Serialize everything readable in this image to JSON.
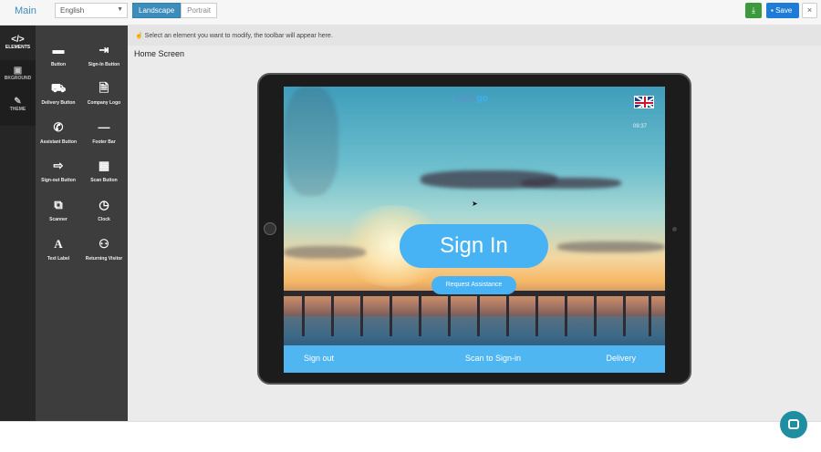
{
  "topbar": {
    "title": "Main",
    "language": "English",
    "orientation": [
      "Landscape",
      "Portrait"
    ],
    "download_icon": "download-icon",
    "save_label": "Save",
    "close_label": "×"
  },
  "rail": [
    {
      "label": "ELEMENTS",
      "icon": "</>"
    },
    {
      "label": "BKGROUND",
      "icon": "▣"
    },
    {
      "label": "THEME",
      "icon": "✎"
    }
  ],
  "palette": [
    {
      "label": "Button",
      "icon": "▬"
    },
    {
      "label": "Sign-In Button",
      "icon": "⇥"
    },
    {
      "label": "Delivery Button",
      "icon": "⛟"
    },
    {
      "label": "Company Logo",
      "icon": "🗎"
    },
    {
      "label": "Assistant Button",
      "icon": "✆"
    },
    {
      "label": "Footer Bar",
      "icon": "—"
    },
    {
      "label": "Sign-out Button",
      "icon": "⇨"
    },
    {
      "label": "Scan Button",
      "icon": "▦"
    },
    {
      "label": "Scanner",
      "icon": "⧉"
    },
    {
      "label": "Clock",
      "icon": "◷"
    },
    {
      "label": "Text Label",
      "icon": "A"
    },
    {
      "label": "Returning Visitor",
      "icon": "⚇"
    }
  ],
  "stage": {
    "hint": "Select an element you want to modify, the toolbar will appear here.",
    "screen_name": "Home Screen"
  },
  "device": {
    "logo_a": "team",
    "logo_b": "go",
    "time": "09:37",
    "signin_label": "Sign In",
    "assist_label": "Request Assistance",
    "footer": {
      "sign_out": "Sign out",
      "scan": "Scan to Sign-in",
      "delivery": "Delivery"
    }
  },
  "colors": {
    "accent": "#3c8dbc",
    "button_blue": "#47b2f4",
    "save_blue": "#1e7bd6",
    "download_green": "#3c9a3c",
    "chat_teal": "#1f8ea0"
  }
}
